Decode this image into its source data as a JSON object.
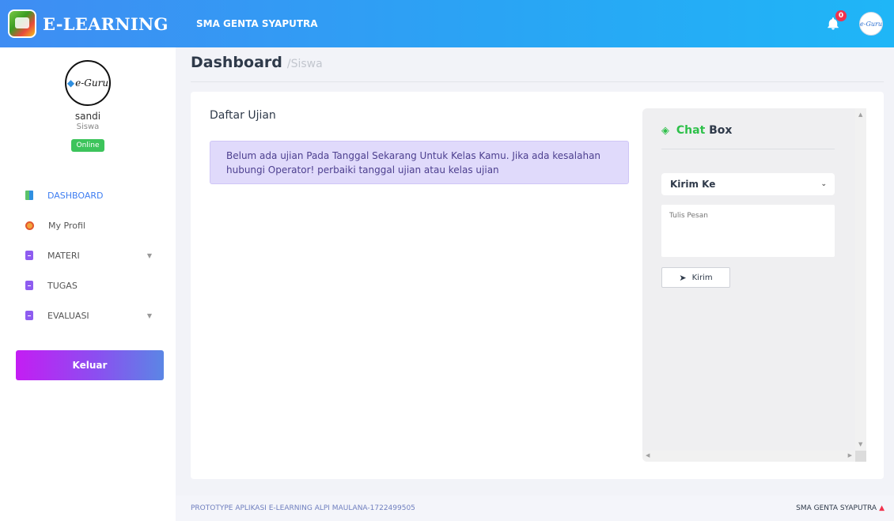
{
  "header": {
    "brand": "E-LEARNING",
    "school": "SMA GENTA SYAPUTRA",
    "notification_count": "0",
    "avatar_text": "e-Guru"
  },
  "sidebar": {
    "avatar_text": "e-Guru",
    "user_name": "sandi",
    "user_role": "Siswa",
    "status": "Online",
    "items": [
      {
        "label": "DASHBOARD",
        "icon": "dashboard-icon",
        "active": true
      },
      {
        "label": "My Profil",
        "icon": "profile-icon"
      },
      {
        "label": "MATERI",
        "icon": "document-icon",
        "has_submenu": true
      },
      {
        "label": "TUGAS",
        "icon": "document-icon"
      },
      {
        "label": "EVALUASI",
        "icon": "document-icon",
        "has_submenu": true
      }
    ],
    "logout_label": "Keluar"
  },
  "page": {
    "title": "Dashboard",
    "subtitle": "/Siswa"
  },
  "main": {
    "card_title": "Daftar Ujian",
    "alert_text": "Belum ada ujian Pada Tanggal Sekarang Untuk Kelas Kamu. Jika ada kesalahan hubungi Operator! perbaiki tanggal ujian atau kelas ujian"
  },
  "chat": {
    "title_green": "Chat",
    "title_dark": "Box",
    "select_value": "Kirim Ke",
    "message_placeholder": "Tulis Pesan",
    "send_label": "Kirim"
  },
  "footer": {
    "left": "PROTOTYPE APLIKASI E-LEARNING ALPI MAULANA-1722499505",
    "right": "SMA GENTA SYAPUTRA"
  },
  "colors": {
    "topbar": "#2aa4f4",
    "active_menu": "#3f7ef2",
    "online": "#3cc45b",
    "chat_green": "#2ec04a",
    "badge": "#f0324d"
  }
}
